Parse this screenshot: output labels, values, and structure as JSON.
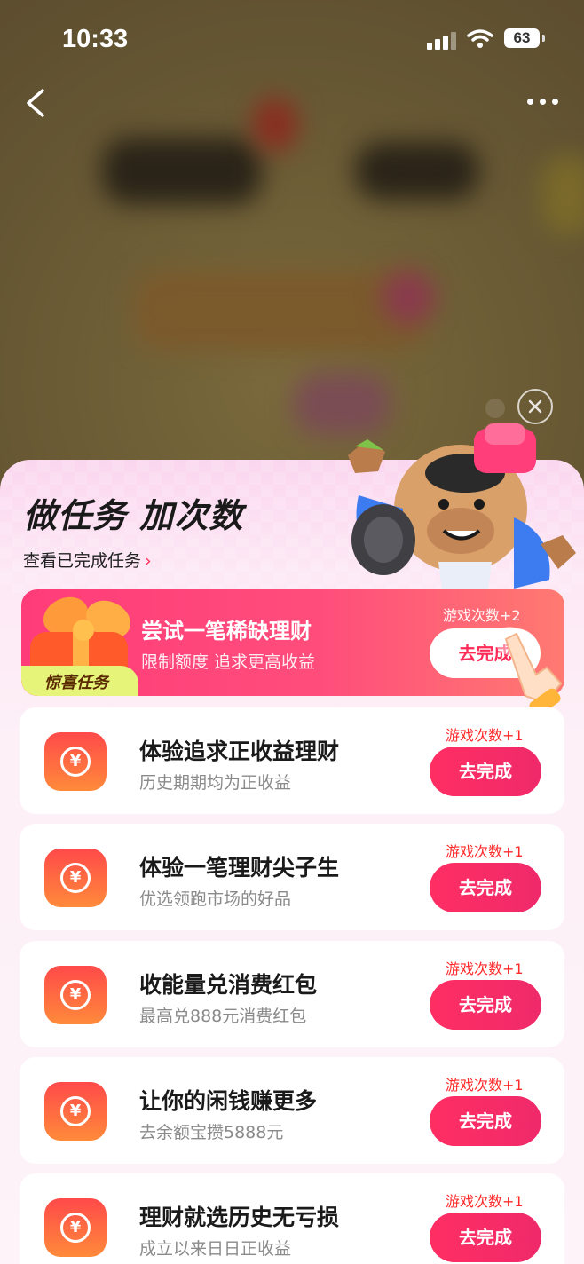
{
  "status_bar": {
    "time": "10:33",
    "battery": "63",
    "icons": [
      "signal-icon",
      "wifi-icon",
      "battery-icon"
    ]
  },
  "nav": {
    "back_icon": "chevron-left-icon",
    "more_icon": "more-horizontal-icon"
  },
  "sheet": {
    "title": "做任务 加次数",
    "view_completed": "查看已完成任务",
    "close_icon": "close-icon"
  },
  "featured_task": {
    "badge": "惊喜任务",
    "title": "尝试一笔稀缺理财",
    "description": "限制额度 追求更高收益",
    "reward": "游戏次数+2",
    "button": "去完成"
  },
  "tasks": [
    {
      "title": "体验追求正收益理财",
      "description": "历史期期均为正收益",
      "reward": "游戏次数+1",
      "button": "去完成",
      "icon": "yuan-coin-icon"
    },
    {
      "title": "体验一笔理财尖子生",
      "description": "优选领跑市场的好品",
      "reward": "游戏次数+1",
      "button": "去完成",
      "icon": "yuan-coin-icon"
    },
    {
      "title": "收能量兑消费红包",
      "description": "最高兑888元消费红包",
      "reward": "游戏次数+1",
      "button": "去完成",
      "icon": "yuan-coin-icon"
    },
    {
      "title": "让你的闲钱赚更多",
      "description": "去余额宝攒5888元",
      "reward": "游戏次数+1",
      "button": "去完成",
      "icon": "yuan-coin-icon"
    },
    {
      "title": "理财就选历史无亏损",
      "description": "成立以来日日正收益",
      "reward": "游戏次数+1",
      "button": "去完成",
      "icon": "yuan-coin-icon"
    }
  ],
  "colors": {
    "accent": "#ff2b57",
    "button_gradient_start": "#ff2e63",
    "featured_gradient_start": "#ff3c7a",
    "featured_gradient_end": "#ff7a71",
    "coin_gradient_start": "#ff4a4a",
    "coin_gradient_end": "#ff8a3a",
    "badge": "#e6f47a"
  }
}
